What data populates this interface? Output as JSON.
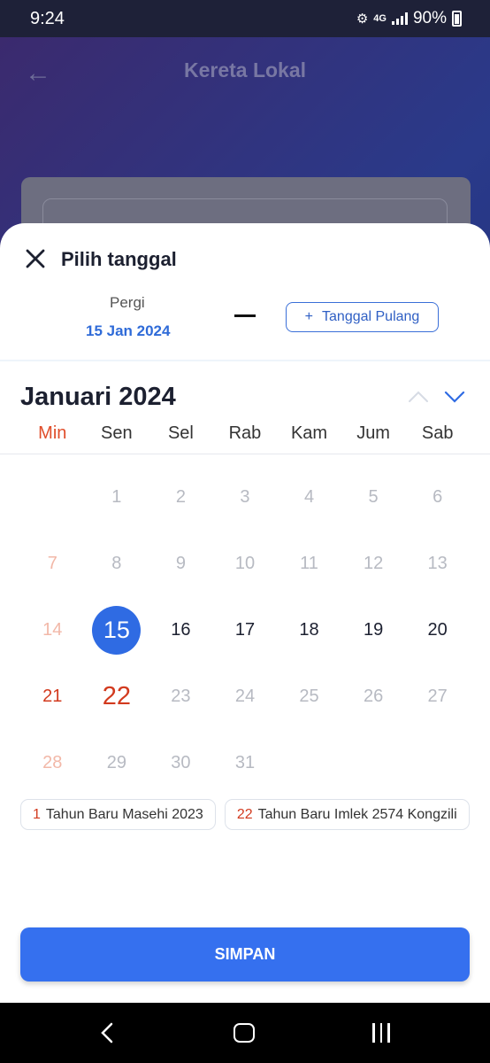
{
  "status": {
    "time": "9:24",
    "network": "4G",
    "battery": "90%"
  },
  "background": {
    "title": "Kereta Lokal"
  },
  "sheet": {
    "title": "Pilih tanggal",
    "depart_label": "Pergi",
    "depart_date": "15 Jan 2024",
    "return_button": "Tanggal Pulang",
    "return_icon": "+"
  },
  "calendar": {
    "month": "Januari 2024",
    "weekdays": [
      "Min",
      "Sen",
      "Sel",
      "Rab",
      "Kam",
      "Jum",
      "Sab"
    ],
    "leading_blanks": 1,
    "selected": 15,
    "days": [
      {
        "n": "1",
        "s": "past"
      },
      {
        "n": "2",
        "s": "past"
      },
      {
        "n": "3",
        "s": "past"
      },
      {
        "n": "4",
        "s": "past"
      },
      {
        "n": "5",
        "s": "past"
      },
      {
        "n": "6",
        "s": "past"
      },
      {
        "n": "7",
        "s": "pastsun"
      },
      {
        "n": "8",
        "s": "past"
      },
      {
        "n": "9",
        "s": "past"
      },
      {
        "n": "10",
        "s": "past"
      },
      {
        "n": "11",
        "s": "past"
      },
      {
        "n": "12",
        "s": "past"
      },
      {
        "n": "13",
        "s": "past"
      },
      {
        "n": "14",
        "s": "pastsun"
      },
      {
        "n": "15",
        "s": "selected"
      },
      {
        "n": "16",
        "s": "active"
      },
      {
        "n": "17",
        "s": "active"
      },
      {
        "n": "18",
        "s": "active"
      },
      {
        "n": "19",
        "s": "active"
      },
      {
        "n": "20",
        "s": "active"
      },
      {
        "n": "21",
        "s": "sun"
      },
      {
        "n": "22",
        "s": "holiday"
      },
      {
        "n": "23",
        "s": "past"
      },
      {
        "n": "24",
        "s": "past"
      },
      {
        "n": "25",
        "s": "past"
      },
      {
        "n": "26",
        "s": "past"
      },
      {
        "n": "27",
        "s": "past"
      },
      {
        "n": "28",
        "s": "pastsun"
      },
      {
        "n": "29",
        "s": "past"
      },
      {
        "n": "30",
        "s": "past"
      },
      {
        "n": "31",
        "s": "past"
      }
    ]
  },
  "holidays": [
    {
      "day": "1",
      "name": "Tahun Baru Masehi 2023"
    },
    {
      "day": "22",
      "name": "Tahun Baru Imlek 2574 Kongzili"
    }
  ],
  "save_button": "SIMPAN",
  "colors": {
    "primary": "#3570ef",
    "sunday": "#d23a1e",
    "selected": "#2f6be3"
  }
}
